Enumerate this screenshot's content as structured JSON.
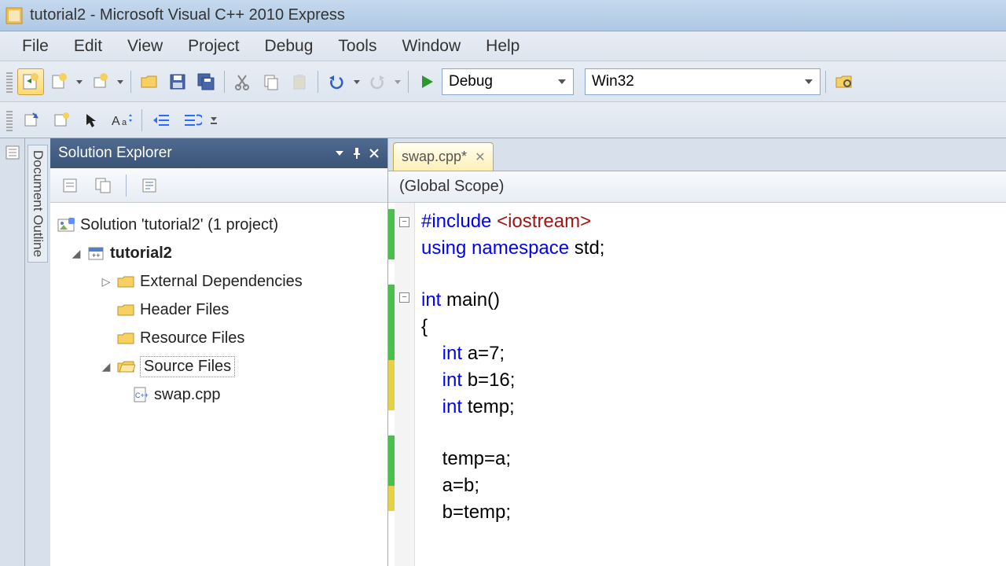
{
  "window": {
    "title": "tutorial2 - Microsoft Visual C++ 2010 Express"
  },
  "menubar": {
    "items": [
      "File",
      "Edit",
      "View",
      "Project",
      "Debug",
      "Tools",
      "Window",
      "Help"
    ]
  },
  "toolbar": {
    "config": "Debug",
    "platform": "Win32"
  },
  "sidebar_tab": {
    "label": "Document Outline"
  },
  "solution_explorer": {
    "title": "Solution Explorer",
    "solution_label": "Solution 'tutorial2' (1 project)",
    "project_name": "tutorial2",
    "folders": {
      "external": "External Dependencies",
      "header": "Header Files",
      "resource": "Resource Files",
      "source": "Source Files"
    },
    "source_file": "swap.cpp"
  },
  "editor": {
    "tab_label": "swap.cpp*",
    "scope": "(Global Scope)",
    "code": {
      "l1a": "#include",
      "l1b": " <iostream>",
      "l2a": "using",
      "l2b": " namespace",
      "l2c": " std;",
      "l4a": "int",
      "l4b": " main()",
      "l5": "{",
      "l6a": "    int",
      "l6b": " a=7;",
      "l7a": "    int",
      "l7b": " b=16;",
      "l8a": "    int",
      "l8b": " temp;",
      "l10": "    temp=a;",
      "l11": "    a=b;",
      "l12": "    b=temp;"
    }
  }
}
